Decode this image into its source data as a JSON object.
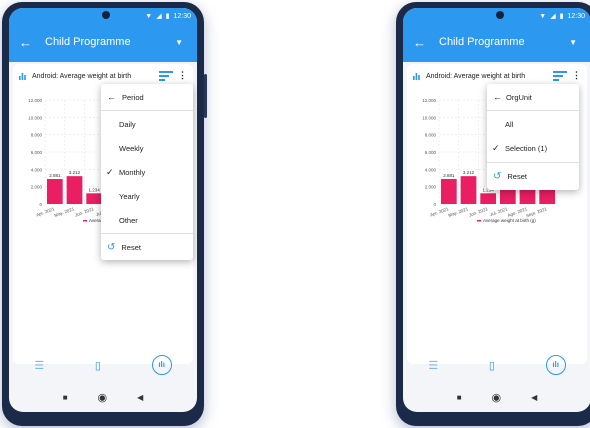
{
  "colors": {
    "primary": "#2c98f0",
    "bar": "#e91e63"
  },
  "status_bar": {
    "time": "12:30"
  },
  "app_bar": {
    "title": "Child Programme"
  },
  "card": {
    "title": "Android: Average weight at birth"
  },
  "chart_data": {
    "type": "bar",
    "categories": [
      "Apr. 2021",
      "May. 2021",
      "Jun. 2021",
      "Jul. 2021",
      "Ago. 2021",
      "Sept. 2021"
    ],
    "series": [
      {
        "name": "Average weight at birth (g)",
        "values": [
          2881,
          3212,
          1234,
          3900,
          3600,
          2395
        ]
      }
    ],
    "data_labels": [
      "2.881",
      "3.212",
      "1.234",
      "",
      "",
      "2.395"
    ],
    "y_ticks": [
      "0",
      "2.000",
      "4.000",
      "6.000",
      "8.000",
      "10.000",
      "12.000"
    ],
    "ylim": [
      0,
      12000
    ],
    "legend_label": "Average weight at birth (g)",
    "legend_label_short": "Ave",
    "grid": true
  },
  "period_menu": {
    "header": "Period",
    "items": [
      "Daily",
      "Weekly",
      "Monthly",
      "Yearly",
      "Other"
    ],
    "selected": "Monthly",
    "reset": "Reset"
  },
  "orgunit_menu": {
    "header": "OrgUnit",
    "items": [
      "All",
      "Selection (1)"
    ],
    "selected": "Selection (1)",
    "reset": "Reset"
  },
  "icons": {
    "back": "arrow-left-icon",
    "dropdown": "caret-down-icon",
    "chart": "bar-chart-icon",
    "filter": "filter-list-icon",
    "more": "more-vert-icon",
    "check": "check-icon",
    "reset": "reset-icon",
    "list": "list-icon",
    "map": "map-icon",
    "analytics": "analytics-icon"
  }
}
